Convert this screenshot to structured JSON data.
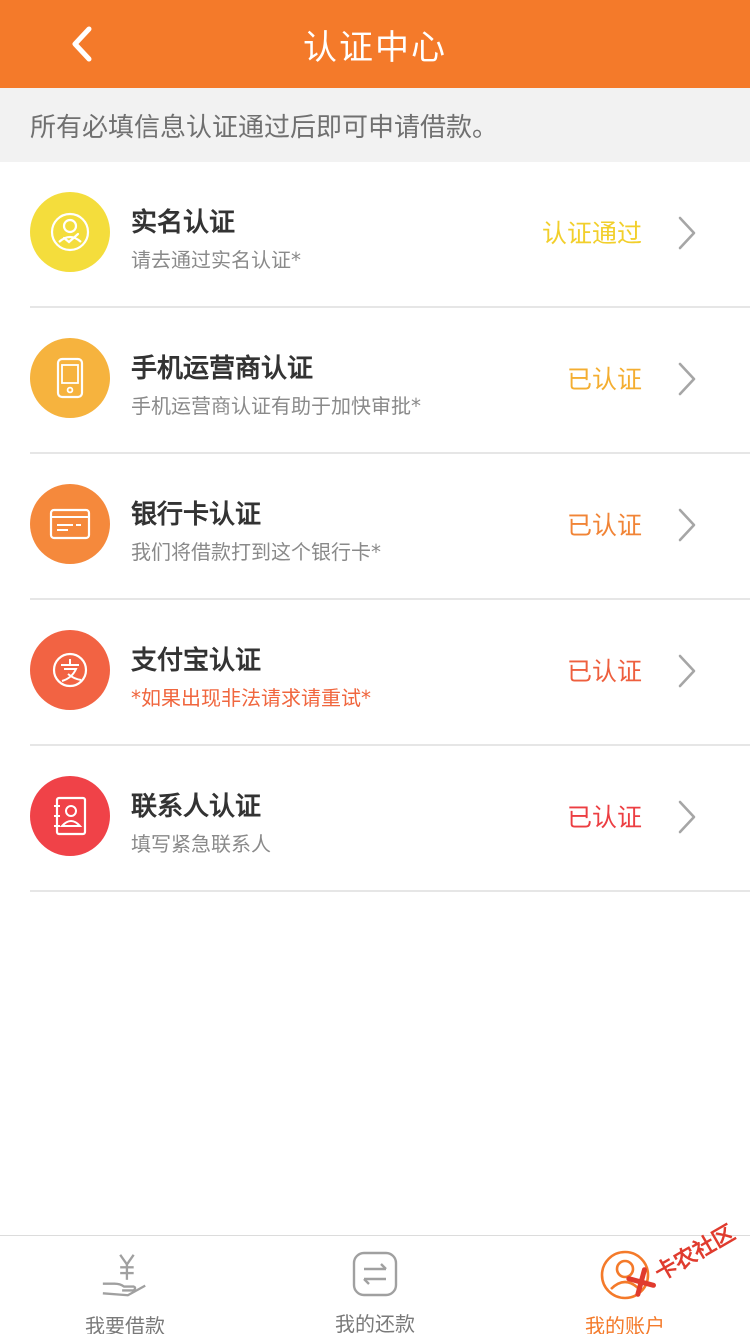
{
  "header": {
    "title": "认证中心"
  },
  "notice": "所有必填信息认证通过后即可申请借款。",
  "items": [
    {
      "title": "实名认证",
      "subtitle": "请去通过实名认证*",
      "status": "认证通过",
      "icon": "id-badge-icon",
      "icon_bg": "#f4dd3c",
      "status_color": "#f2cf2b",
      "subtitle_color": "#8a8a8a"
    },
    {
      "title": "手机运营商认证",
      "subtitle": "手机运营商认证有助于加快审批*",
      "status": "已认证",
      "icon": "phone-icon",
      "icon_bg": "#f6b33e",
      "status_color": "#f4ae31",
      "subtitle_color": "#8a8a8a"
    },
    {
      "title": "银行卡认证",
      "subtitle": "我们将借款打到这个银行卡*",
      "status": "已认证",
      "icon": "bank-card-icon",
      "icon_bg": "#f5893c",
      "status_color": "#f18436",
      "subtitle_color": "#8a8a8a"
    },
    {
      "title": "支付宝认证",
      "subtitle": "*如果出现非法请求请重试*",
      "status": "已认证",
      "icon": "alipay-icon",
      "icon_bg": "#f26343",
      "status_color": "#ee5f3e",
      "subtitle_color": "#f0663e"
    },
    {
      "title": "联系人认证",
      "subtitle": "填写紧急联系人",
      "status": "已认证",
      "icon": "contact-book-icon",
      "icon_bg": "#f04248",
      "status_color": "#ec3e42",
      "subtitle_color": "#8a8a8a"
    }
  ],
  "tabs": [
    {
      "label": "我要借款",
      "icon": "yen-hand-icon",
      "active": false
    },
    {
      "label": "我的还款",
      "icon": "exchange-icon",
      "active": false
    },
    {
      "label": "我的账户",
      "icon": "user-icon",
      "active": true
    }
  ],
  "watermark": "卡农社区",
  "colors": {
    "header_bg": "#f47a2a",
    "active_tab": "#f47a2a",
    "inactive_tab": "#9a9a9a"
  }
}
